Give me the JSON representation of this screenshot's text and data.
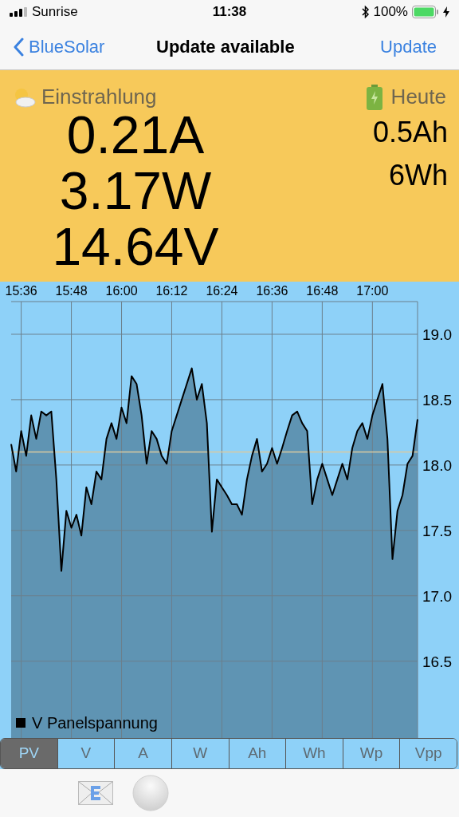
{
  "status_bar": {
    "carrier": "Sunrise",
    "time": "11:38",
    "battery": "100%"
  },
  "nav": {
    "back": "BlueSolar",
    "title": "Update available",
    "action": "Update"
  },
  "summary": {
    "left_label": "Einstrahlung",
    "right_label": "Heute",
    "readings": [
      "0.21A",
      "3.17W",
      "14.64V"
    ],
    "totals": [
      "0.5Ah",
      "6Wh"
    ]
  },
  "chart_data": {
    "type": "area",
    "ylim": [
      15.9,
      19.25
    ],
    "categories": [
      null,
      null,
      "15:36",
      null,
      null,
      null,
      null,
      null,
      null,
      null,
      null,
      null,
      "15:48",
      null,
      null,
      null,
      null,
      null,
      null,
      null,
      null,
      null,
      "16:00",
      null,
      null,
      null,
      null,
      null,
      null,
      null,
      null,
      null,
      "16:12",
      null,
      null,
      null,
      null,
      null,
      null,
      null,
      null,
      null,
      "16:24",
      null,
      null,
      null,
      null,
      null,
      null,
      null,
      null,
      null,
      "16:36",
      null,
      null,
      null,
      null,
      null,
      null,
      null,
      null,
      null,
      "16:48",
      null,
      null,
      null,
      null,
      null,
      null,
      null,
      null,
      null,
      "17:00",
      null,
      null,
      null,
      null,
      null,
      null,
      null,
      null,
      null
    ],
    "yticks": [
      {
        "value": 19,
        "label": "19.0"
      },
      {
        "value": 18.5,
        "label": "18.5"
      },
      {
        "value": 18,
        "label": "18.0"
      },
      {
        "value": 17.5,
        "label": "17.5"
      },
      {
        "value": 17,
        "label": "17.0"
      },
      {
        "value": 16.5,
        "label": "16.5"
      }
    ],
    "series": [
      {
        "name": "V Panelspannung",
        "color": "#000000",
        "values": [
          18.16,
          17.95,
          18.26,
          18.07,
          18.38,
          18.2,
          18.41,
          18.38,
          18.41,
          17.89,
          17.19,
          17.65,
          17.52,
          17.62,
          17.46,
          17.83,
          17.7,
          17.95,
          17.89,
          18.2,
          18.32,
          18.2,
          18.44,
          18.32,
          18.68,
          18.62,
          18.38,
          18.01,
          18.26,
          18.2,
          18.07,
          18.01,
          18.26,
          18.38,
          18.5,
          18.62,
          18.74,
          18.5,
          18.62,
          18.32,
          17.49,
          17.89,
          17.83,
          17.77,
          17.7,
          17.7,
          17.62,
          17.89,
          18.07,
          18.2,
          17.95,
          18.01,
          18.13,
          18.01,
          18.13,
          18.26,
          18.38,
          18.41,
          18.32,
          18.26,
          17.7,
          17.89,
          18.01,
          17.89,
          17.77,
          17.89,
          18.01,
          17.89,
          18.13,
          18.26,
          18.32,
          18.2,
          18.38,
          18.5,
          18.62,
          18.2,
          17.28,
          17.65,
          17.77,
          18.01,
          18.07,
          18.35
        ]
      }
    ],
    "grid": true,
    "ref_lines": [
      {
        "axis": "y",
        "value": 18.1,
        "color": "#d9c9a0"
      }
    ]
  },
  "tabs": [
    {
      "label": "PV",
      "selected": true
    },
    {
      "label": "V",
      "selected": false
    },
    {
      "label": "A",
      "selected": false
    },
    {
      "label": "W",
      "selected": false
    },
    {
      "label": "Ah",
      "selected": false
    },
    {
      "label": "Wh",
      "selected": false
    },
    {
      "label": "Wp",
      "selected": false
    },
    {
      "label": "Vpp",
      "selected": false
    }
  ]
}
